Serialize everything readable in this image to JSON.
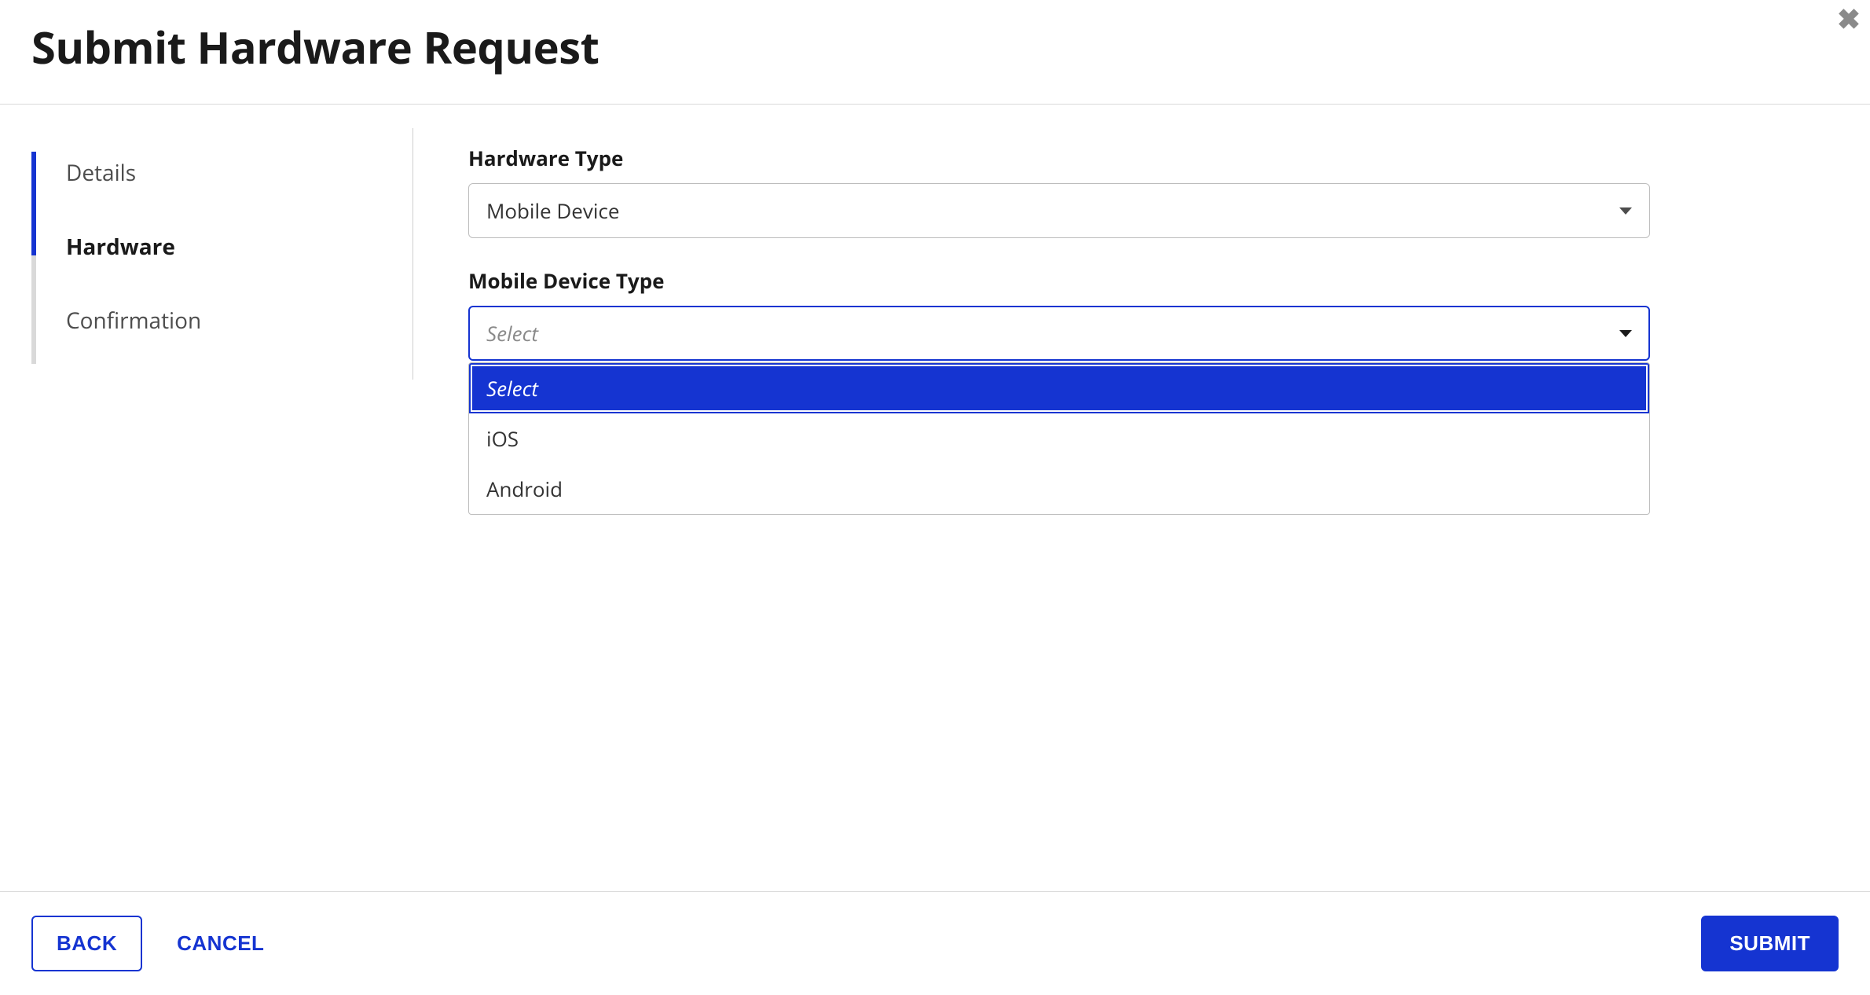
{
  "header": {
    "title": "Submit Hardware Request"
  },
  "sidebar": {
    "steps": [
      {
        "label": "Details"
      },
      {
        "label": "Hardware"
      },
      {
        "label": "Confirmation"
      }
    ],
    "active_index": 1
  },
  "form": {
    "hardware_type": {
      "label": "Hardware Type",
      "value": "Mobile Device"
    },
    "mobile_device_type": {
      "label": "Mobile Device Type",
      "placeholder": "Select",
      "options": [
        {
          "label": "Select"
        },
        {
          "label": "iOS"
        },
        {
          "label": "Android"
        }
      ],
      "highlighted_index": 0
    }
  },
  "footer": {
    "back": "BACK",
    "cancel": "CANCEL",
    "submit": "SUBMIT"
  }
}
